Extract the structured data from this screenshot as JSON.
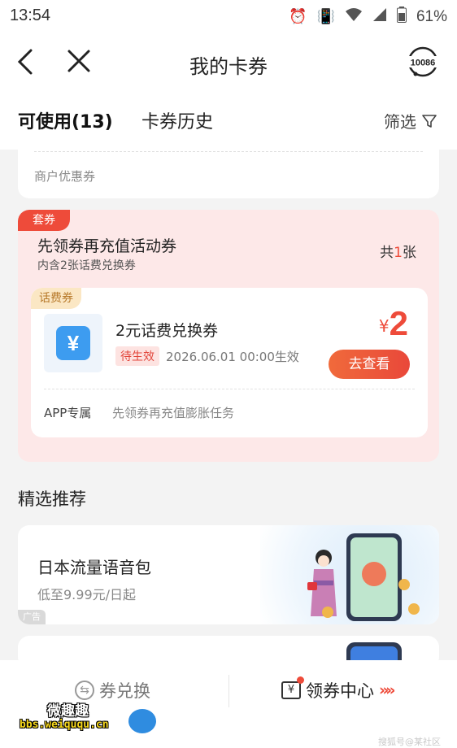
{
  "status_bar": {
    "time": "13:54",
    "battery": "61%"
  },
  "header": {
    "title": "我的卡券",
    "hotline": "10086"
  },
  "tabs": {
    "available": "可使用(13)",
    "history": "卡券历史",
    "filter": "筛选"
  },
  "partial_card": {
    "label": "商户优惠券"
  },
  "bundle": {
    "badge": "套券",
    "title": "先领券再充值活动券",
    "subtitle": "内含2张话费兑换券",
    "count_prefix": "共",
    "count": "1",
    "count_suffix": "张",
    "coupon": {
      "badge": "话费券",
      "icon_symbol": "¥",
      "name": "2元话费兑换券",
      "status": "待生效",
      "valid_time": "2026.06.01 00:00生效",
      "currency": "¥",
      "amount": "2",
      "button": "去查看",
      "tag": "APP专属",
      "desc": "先领券再充值膨胀任务"
    }
  },
  "recommend": {
    "title": "精选推荐",
    "items": [
      {
        "title": "日本流量语音包",
        "subtitle": "低至9.99元/日起",
        "ad": "广告"
      }
    ]
  },
  "bottom_bar": {
    "exchange": "券兑换",
    "center": "领券中心",
    "center_icon": "¥",
    "arrows": "»»"
  },
  "watermark": {
    "cn": "微趣趣",
    "url": "bbs.weiququ.cn",
    "corner": "搜狐号@某社区"
  }
}
